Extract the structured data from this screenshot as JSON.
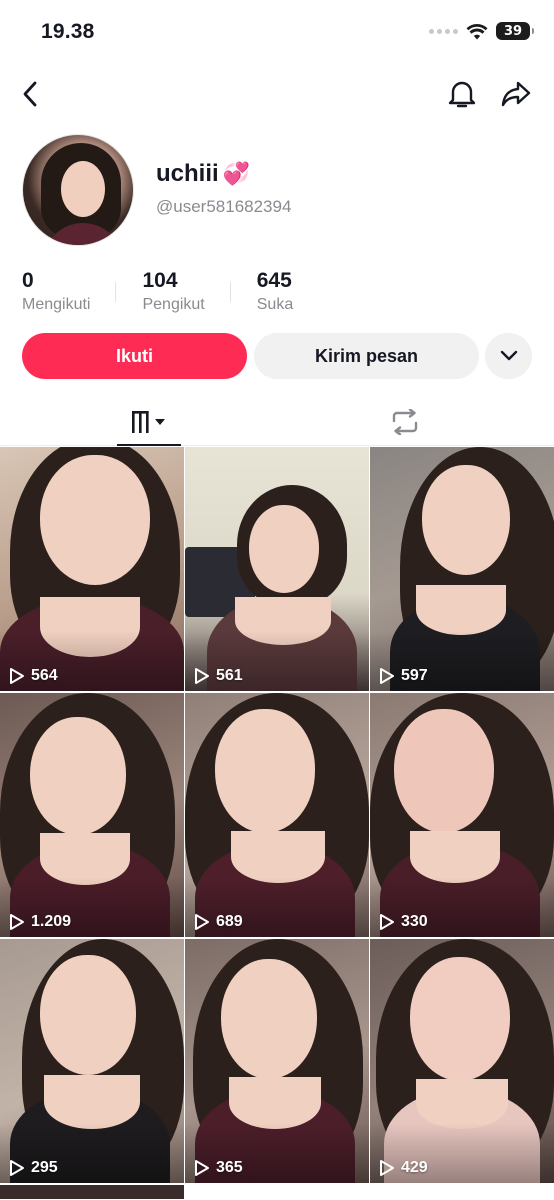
{
  "status_bar": {
    "time": "19.38",
    "battery_level": "39"
  },
  "nav": {
    "back_icon": "chevron-left-icon",
    "bell_icon": "bell-icon",
    "share_icon": "share-arrow-icon"
  },
  "profile": {
    "username": "uchiii",
    "username_emoji": "💞",
    "handle": "@user581682394"
  },
  "stats": [
    {
      "value": "0",
      "label": "Mengikuti"
    },
    {
      "value": "104",
      "label": "Pengikut"
    },
    {
      "value": "645",
      "label": "Suka"
    }
  ],
  "actions": {
    "follow_label": "Ikuti",
    "message_label": "Kirim pesan",
    "more_icon": "chevron-down-icon"
  },
  "tabs": {
    "videos_icon": "grid-bars-icon",
    "repost_icon": "repost-icon"
  },
  "videos": [
    {
      "views": "564"
    },
    {
      "views": "561"
    },
    {
      "views": "597"
    },
    {
      "views": "1.209"
    },
    {
      "views": "689"
    },
    {
      "views": "330"
    },
    {
      "views": "295"
    },
    {
      "views": "365"
    },
    {
      "views": "429"
    }
  ],
  "colors": {
    "accent": "#fe2c55",
    "secondary_button": "#f1f1f2",
    "text_primary": "#161823",
    "text_secondary": "#8a8b91"
  }
}
